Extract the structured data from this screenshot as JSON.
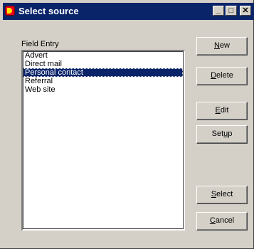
{
  "window": {
    "title": "Select source",
    "minimize_glyph": "_",
    "maximize_glyph": "□",
    "close_glyph": "✕"
  },
  "field_label": "Field Entry",
  "list": {
    "items": [
      "Advert",
      "Direct mail",
      "Personal contact",
      "Referral",
      "Web site"
    ],
    "selected": "Personal contact"
  },
  "buttons": {
    "new_label": "New",
    "delete_label": "Delete",
    "edit_label": "Edit",
    "setup_label": "Setup",
    "select_label": "Select",
    "cancel_label": "Cancel"
  },
  "colors": {
    "titlebar": "#0a246a",
    "selection": "#0a246a",
    "face": "#d4d0c8"
  }
}
